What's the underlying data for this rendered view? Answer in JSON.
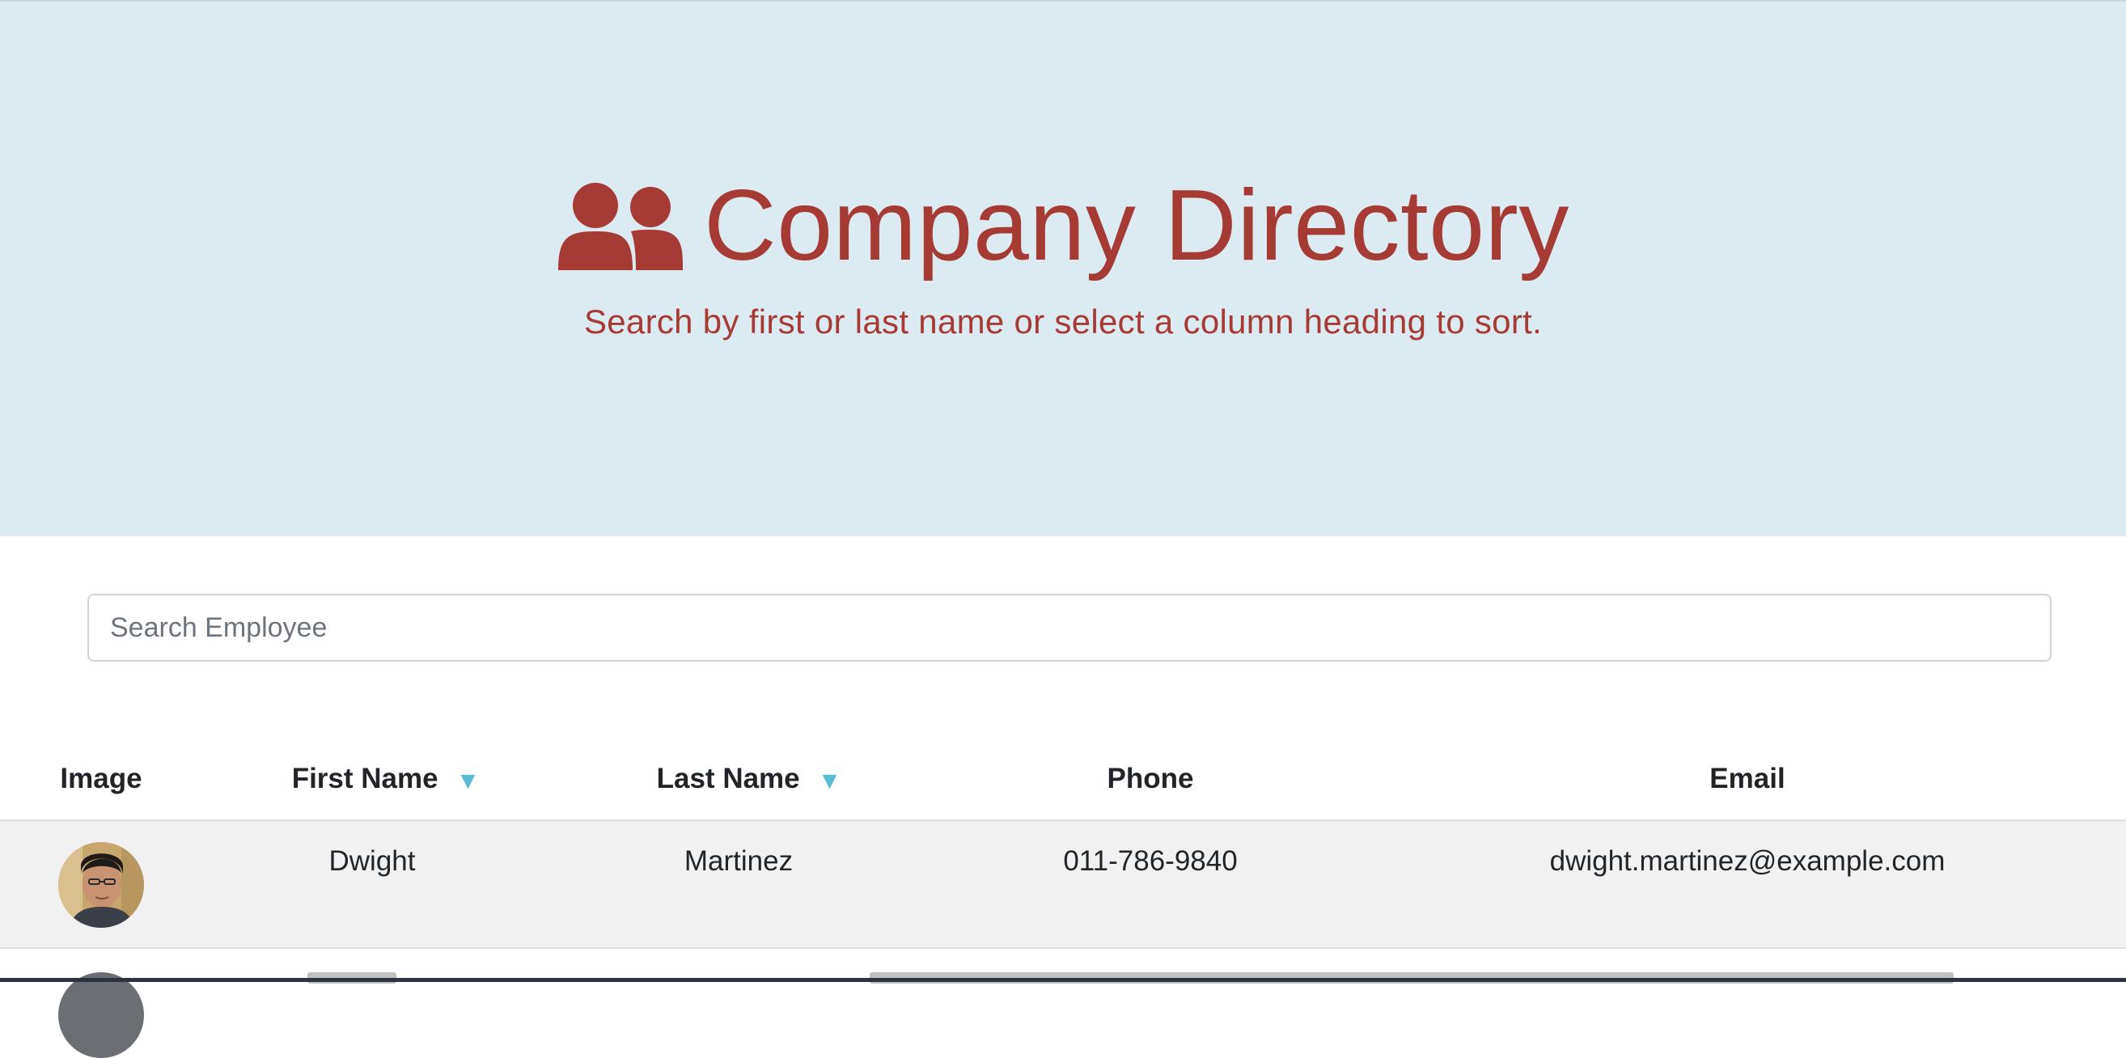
{
  "header": {
    "title": "Company Directory",
    "subtitle": "Search by first or last name or select a column heading to sort.",
    "icon": "users-icon",
    "accent_color": "#a63a35",
    "background_color": "#dcebf1"
  },
  "search": {
    "placeholder": "Search Employee",
    "value": ""
  },
  "table": {
    "columns": [
      {
        "label": "Image",
        "sortable": false
      },
      {
        "label": "First Name",
        "sortable": true,
        "sort_icon": "caret-down-icon"
      },
      {
        "label": "Last Name",
        "sortable": true,
        "sort_icon": "caret-down-icon"
      },
      {
        "label": "Phone",
        "sortable": false
      },
      {
        "label": "Email",
        "sortable": false
      }
    ],
    "sort_arrow_glyph": "▼",
    "rows": [
      {
        "image": "employee-avatar",
        "first_name": "Dwight",
        "last_name": "Martinez",
        "phone": "011-786-9840",
        "email": "dwight.martinez@example.com"
      }
    ]
  }
}
